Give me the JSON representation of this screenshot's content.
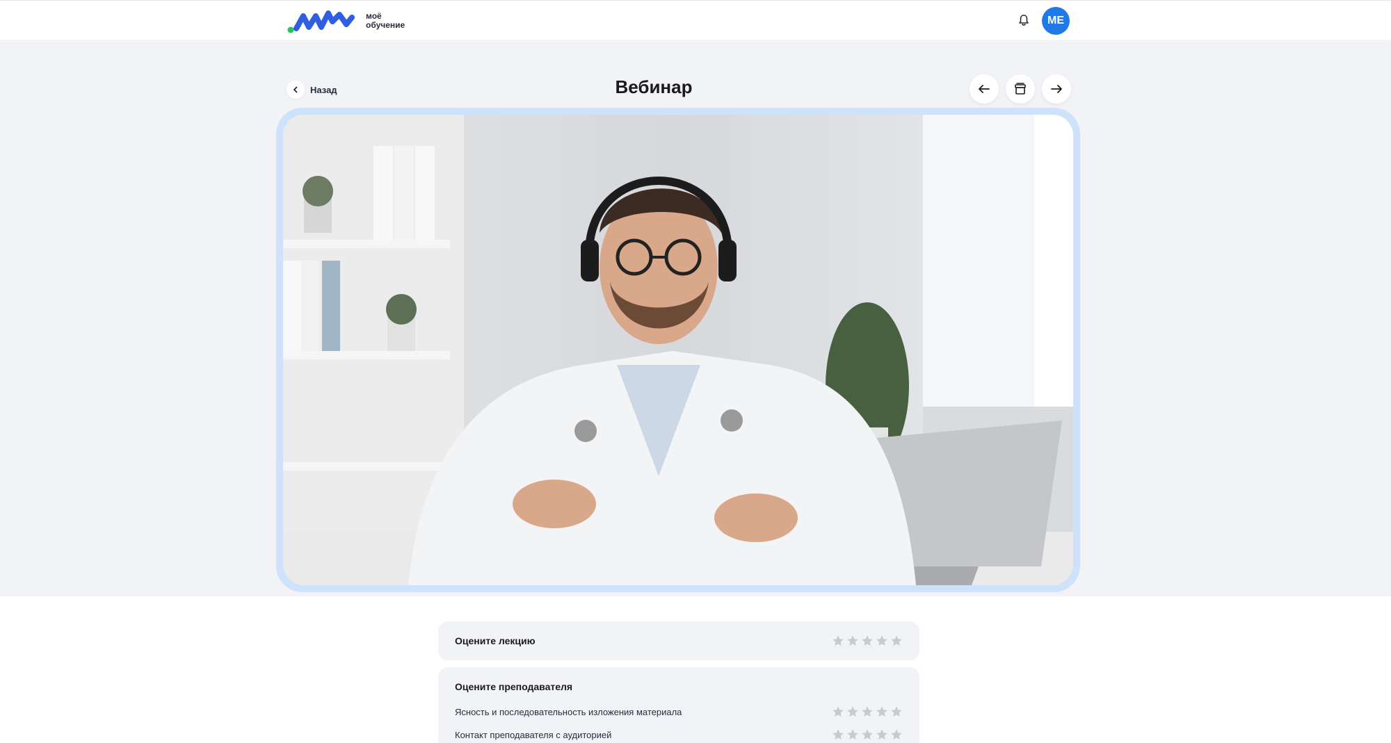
{
  "header": {
    "logo_line1": "моё",
    "logo_line2": "обучение",
    "avatar_initials": "МЕ"
  },
  "page": {
    "back_label": "Назад",
    "title": "Вебинар"
  },
  "ratings": {
    "lecture_title": "Оцените лекцию",
    "teacher_title": "Оцените преподавателя",
    "criteria": [
      "Ясность и последовательность изложения материала",
      "Контакт преподавателя с аудиторией"
    ],
    "max_stars": 5
  },
  "colors": {
    "accent": "#1f7ae8",
    "frame": "#cfe2fb",
    "star_empty": "#c8cad0",
    "background": "#f2f3f7"
  }
}
